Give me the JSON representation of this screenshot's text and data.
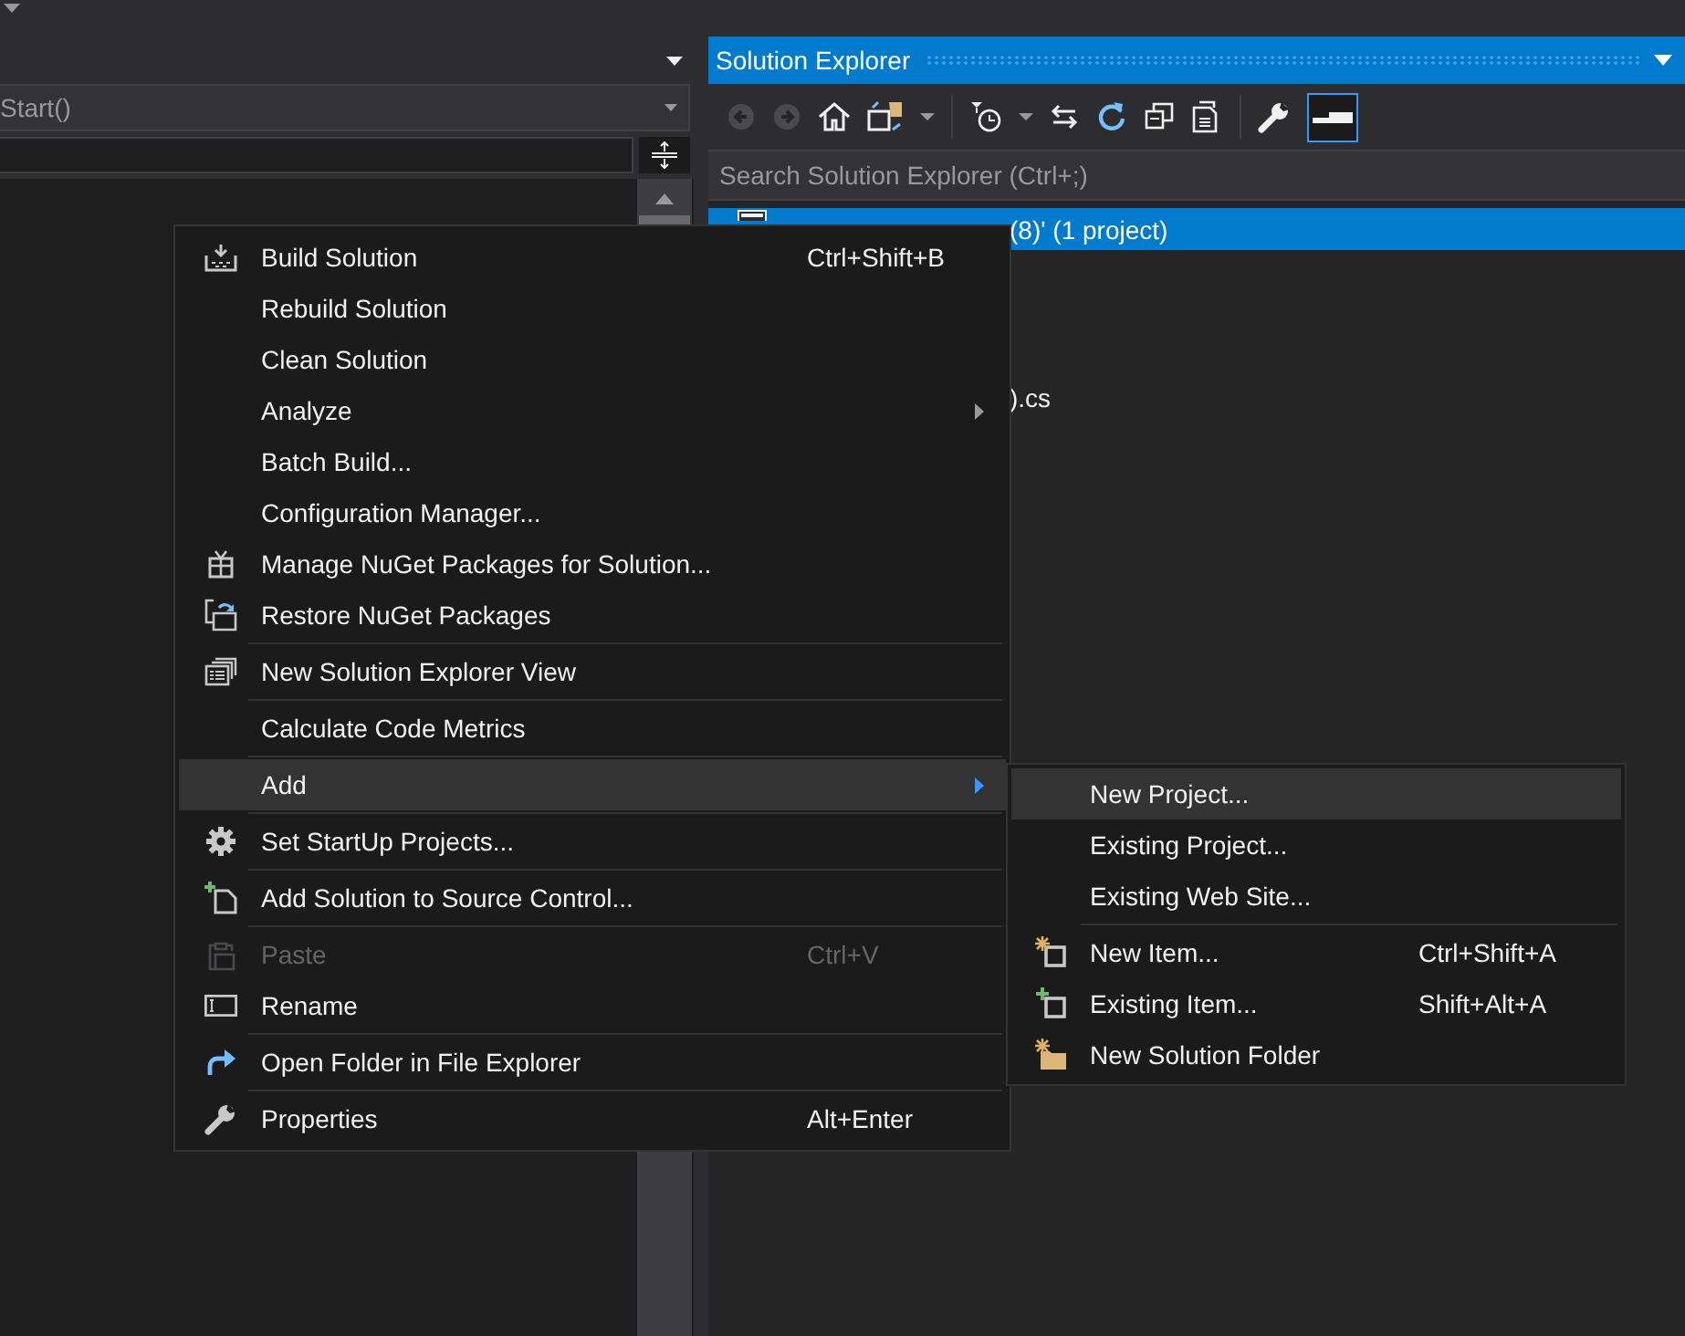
{
  "editor": {
    "navigation_dropdown": {
      "value": "Start()"
    }
  },
  "solution_explorer": {
    "title": "Solution Explorer",
    "search": {
      "placeholder": "Search Solution Explorer (Ctrl+;)"
    },
    "tree": [
      {
        "text": "(8)' (1 project)",
        "selected": true
      },
      {
        "text": ").cs",
        "selected": false
      }
    ]
  },
  "context_menu": {
    "groups": [
      [
        {
          "label": "Build Solution",
          "shortcut": "Ctrl+Shift+B",
          "submenu": false,
          "disabled": false,
          "selected": false
        },
        {
          "label": "Rebuild Solution",
          "submenu": false,
          "disabled": false,
          "selected": false
        },
        {
          "label": "Clean Solution",
          "submenu": false,
          "disabled": false,
          "selected": false
        },
        {
          "label": "Analyze",
          "submenu": true,
          "disabled": false,
          "selected": false
        },
        {
          "label": "Batch Build...",
          "submenu": false,
          "disabled": false,
          "selected": false
        },
        {
          "label": "Configuration Manager...",
          "submenu": false,
          "disabled": false,
          "selected": false
        },
        {
          "label": "Manage NuGet Packages for Solution...",
          "submenu": false,
          "disabled": false,
          "selected": false
        },
        {
          "label": "Restore NuGet Packages",
          "submenu": false,
          "disabled": false,
          "selected": false
        }
      ],
      [
        {
          "label": "New Solution Explorer View",
          "submenu": false,
          "disabled": false,
          "selected": false
        }
      ],
      [
        {
          "label": "Calculate Code Metrics",
          "submenu": false,
          "disabled": false,
          "selected": false
        }
      ],
      [
        {
          "label": "Add",
          "submenu": true,
          "disabled": false,
          "selected": true
        }
      ],
      [
        {
          "label": "Set StartUp Projects...",
          "submenu": false,
          "disabled": false,
          "selected": false
        }
      ],
      [
        {
          "label": "Add Solution to Source Control...",
          "submenu": false,
          "disabled": false,
          "selected": false
        }
      ],
      [
        {
          "label": "Paste",
          "shortcut": "Ctrl+V",
          "submenu": false,
          "disabled": true,
          "selected": false
        },
        {
          "label": "Rename",
          "submenu": false,
          "disabled": false,
          "selected": false
        }
      ],
      [
        {
          "label": "Open Folder in File Explorer",
          "submenu": false,
          "disabled": false,
          "selected": false
        }
      ],
      [
        {
          "label": "Properties",
          "shortcut": "Alt+Enter",
          "submenu": false,
          "disabled": false,
          "selected": false
        }
      ]
    ]
  },
  "add_submenu": {
    "groups": [
      [
        {
          "label": "New Project...",
          "disabled": false,
          "selected": true
        },
        {
          "label": "Existing Project...",
          "disabled": false,
          "selected": false
        },
        {
          "label": "Existing Web Site...",
          "disabled": false,
          "selected": false
        }
      ],
      [
        {
          "label": "New Item...",
          "shortcut": "Ctrl+Shift+A",
          "disabled": false,
          "selected": false
        },
        {
          "label": "Existing Item...",
          "shortcut": "Shift+Alt+A",
          "disabled": false,
          "selected": false
        },
        {
          "label": "New Solution Folder",
          "disabled": false,
          "selected": false
        }
      ]
    ]
  }
}
